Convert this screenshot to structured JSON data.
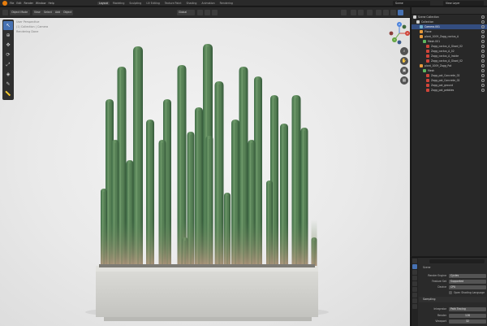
{
  "app": {
    "menu": [
      "File",
      "Edit",
      "Render",
      "Window",
      "Help"
    ],
    "workspace_tabs": [
      "Layout",
      "Modeling",
      "Sculpting",
      "UV Editing",
      "Texture Paint",
      "Shading",
      "Animation",
      "Rendering"
    ],
    "active_workspace": "Layout",
    "scene": "Scene",
    "view_layer": "View Layer"
  },
  "viewport": {
    "mode": "Object Mode",
    "menus": [
      "View",
      "Select",
      "Add",
      "Object"
    ],
    "orientation": "Global",
    "overlay_lines": [
      "User Perspective",
      "(1) Collection | Camera",
      "Rendering Done"
    ],
    "gizmo_axes": [
      "X",
      "Y",
      "Z"
    ]
  },
  "outliner": {
    "header_search": "",
    "rows": [
      {
        "label": "Scene Collection",
        "indent": 0,
        "icon": "collection-icon",
        "icon_color": "#cfcfcf",
        "selected": false
      },
      {
        "label": "Collection",
        "indent": 1,
        "icon": "collection-icon",
        "icon_color": "#cfcfcf",
        "selected": false
      },
      {
        "label": "Camera.001",
        "indent": 2,
        "icon": "camera-icon",
        "icon_color": "#6fb0c9",
        "selected": true
      },
      {
        "label": "Plane",
        "indent": 2,
        "icon": "mesh-icon",
        "icon_color": "#e89b3c",
        "selected": false
      },
      {
        "label": "plant_1009_Zagg_cactus_A",
        "indent": 2,
        "icon": "object-icon",
        "icon_color": "#e89b3c",
        "selected": false
      },
      {
        "label": "Mesh.001",
        "indent": 3,
        "icon": "mesh-data-icon",
        "icon_color": "#5fb85f",
        "selected": false
      },
      {
        "label": "Zagg_cactus_A_Glazd_02",
        "indent": 4,
        "icon": "material-icon",
        "icon_color": "#d0453a",
        "selected": false
      },
      {
        "label": "Zagg_cactus_A_02",
        "indent": 4,
        "icon": "material-icon",
        "icon_color": "#d0453a",
        "selected": false
      },
      {
        "label": "Zagg_cactus_A_Inside",
        "indent": 4,
        "icon": "material-icon",
        "icon_color": "#d0453a",
        "selected": false
      },
      {
        "label": "Zagg_cactus_A_Glazd_02",
        "indent": 4,
        "icon": "material-icon",
        "icon_color": "#d0453a",
        "selected": false
      },
      {
        "label": "plant_1009_Zagg_Pot",
        "indent": 2,
        "icon": "object-icon",
        "icon_color": "#e89b3c",
        "selected": false
      },
      {
        "label": "Mesh",
        "indent": 3,
        "icon": "mesh-data-icon",
        "icon_color": "#5fb85f",
        "selected": false
      },
      {
        "label": "Zagg_pot_Concrete_02",
        "indent": 4,
        "icon": "material-icon",
        "icon_color": "#d0453a",
        "selected": false
      },
      {
        "label": "Zagg_pot_Concrete_02",
        "indent": 4,
        "icon": "material-icon",
        "icon_color": "#d0453a",
        "selected": false
      },
      {
        "label": "Zagg_pot_ground",
        "indent": 4,
        "icon": "material-icon",
        "icon_color": "#d0453a",
        "selected": false
      },
      {
        "label": "Zagg_pot_pebbles",
        "indent": 4,
        "icon": "material-icon",
        "icon_color": "#d0453a",
        "selected": false
      }
    ]
  },
  "properties": {
    "search": "",
    "scene_label": "Scene",
    "render_engine_label": "Render Engine",
    "render_engine_value": "Cycles",
    "feature_set_label": "Feature Set",
    "feature_set_value": "Supported",
    "device_label": "Device",
    "device_value": "CPU",
    "osl_label": "Open Shading Language",
    "sampling_label": "Sampling",
    "integrator_label": "Integrator",
    "integrator_value": "Path Tracing",
    "render_label": "Render",
    "render_value": "128",
    "viewport_label": "Viewport",
    "viewport_value": "32"
  },
  "colors": {
    "accent": "#4772b3",
    "selected_row": "#334d80",
    "cactus_green": "#5d8a5c",
    "cactus_tip": "#c49a86",
    "pot_concrete": "#d4d4d0"
  }
}
